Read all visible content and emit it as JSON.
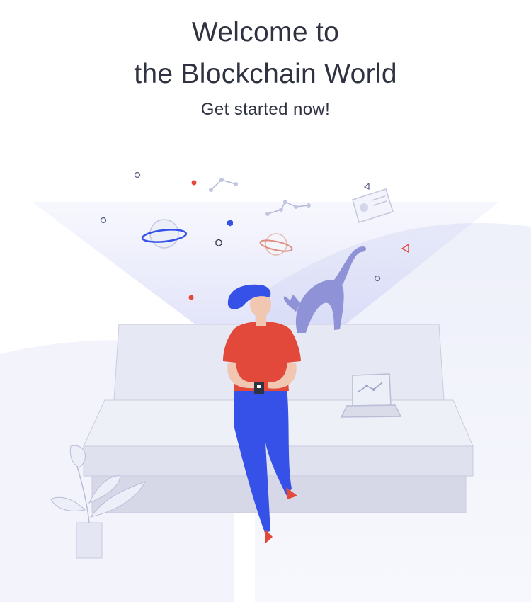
{
  "welcome": {
    "title_line1": "Welcome to",
    "title_line2": "the Blockchain World",
    "subtitle": "Get started now!"
  },
  "colors": {
    "text": "#2f3240",
    "accent_blue": "#3551e8",
    "accent_red": "#e2493b",
    "sofa": "#e3e5f2",
    "cat": "#8c8fd4"
  },
  "icons": [
    "planet-icon",
    "planet-ring-icon",
    "node-graph-icon",
    "id-card-icon",
    "laptop-icon",
    "phone-icon",
    "plant-icon",
    "cat-icon"
  ]
}
